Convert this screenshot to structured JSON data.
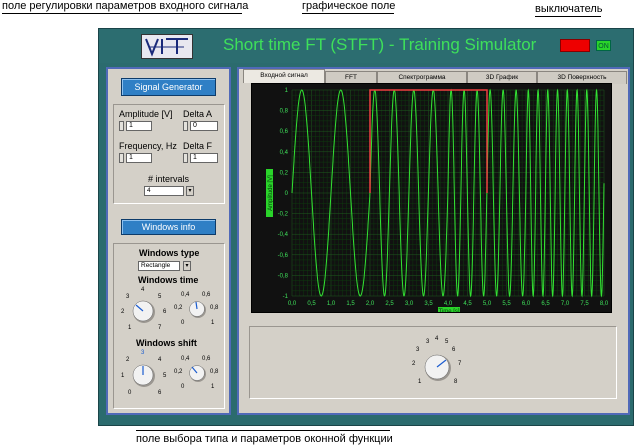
{
  "annotations": {
    "input_params": "поле регулировки параметров входного сигнала",
    "graph_field": "графическое поле",
    "switch": "выключатель",
    "window_select": "поле выбора типа и параметров оконной функции"
  },
  "header": {
    "title": "Short time FT (STFT) - Training Simulator",
    "power_label": "ON",
    "title_color": "#3ee05a"
  },
  "left": {
    "signal_button": "Signal Generator",
    "amplitude_label": "Amplitude [V]",
    "amplitude_value": "1",
    "delta_a_label": "Delta A",
    "delta_a_value": "0",
    "frequency_label": "Frequency, Hz",
    "frequency_value": "1",
    "delta_f_label": "Delta F",
    "delta_f_value": "1",
    "intervals_label": "# intervals",
    "intervals_value": "4",
    "windows_button": "Windows info",
    "windows_type_label": "Windows type",
    "windows_type_value": "Rectangle",
    "windows_time_label": "Windows time",
    "windows_shift_label": "Windows shift"
  },
  "tabs": [
    "Входной сигнал",
    "FFT",
    "Спектрограмма",
    "3D График",
    "3D Поверхность"
  ],
  "chart_data": {
    "type": "line",
    "xlabel": "Time [s]",
    "ylabel": "Amplitude [V]",
    "xlim": [
      0,
      8
    ],
    "ylim": [
      -1,
      1
    ],
    "x_ticks": [
      "0,0",
      "0,5",
      "1,0",
      "1,5",
      "2,0",
      "2,5",
      "3,0",
      "3,5",
      "4,0",
      "4,5",
      "5,0",
      "5,5",
      "6,0",
      "6,5",
      "7,0",
      "7,5",
      "8,0"
    ],
    "y_ticks": [
      "1",
      "0,8",
      "0,6",
      "0,4",
      "0,2",
      "0",
      "-0,2",
      "-0,4",
      "-0,6",
      "-0,8",
      "-1"
    ],
    "series": [
      {
        "kind": "chirp",
        "amplitude": 1,
        "start_frequency_hz": 1,
        "frequency_step_hz": 1,
        "intervals": 4,
        "color": "#33e233"
      },
      {
        "kind": "window",
        "start": 2.0,
        "end": 5.0,
        "level": 1,
        "color": "#f04040"
      }
    ]
  }
}
